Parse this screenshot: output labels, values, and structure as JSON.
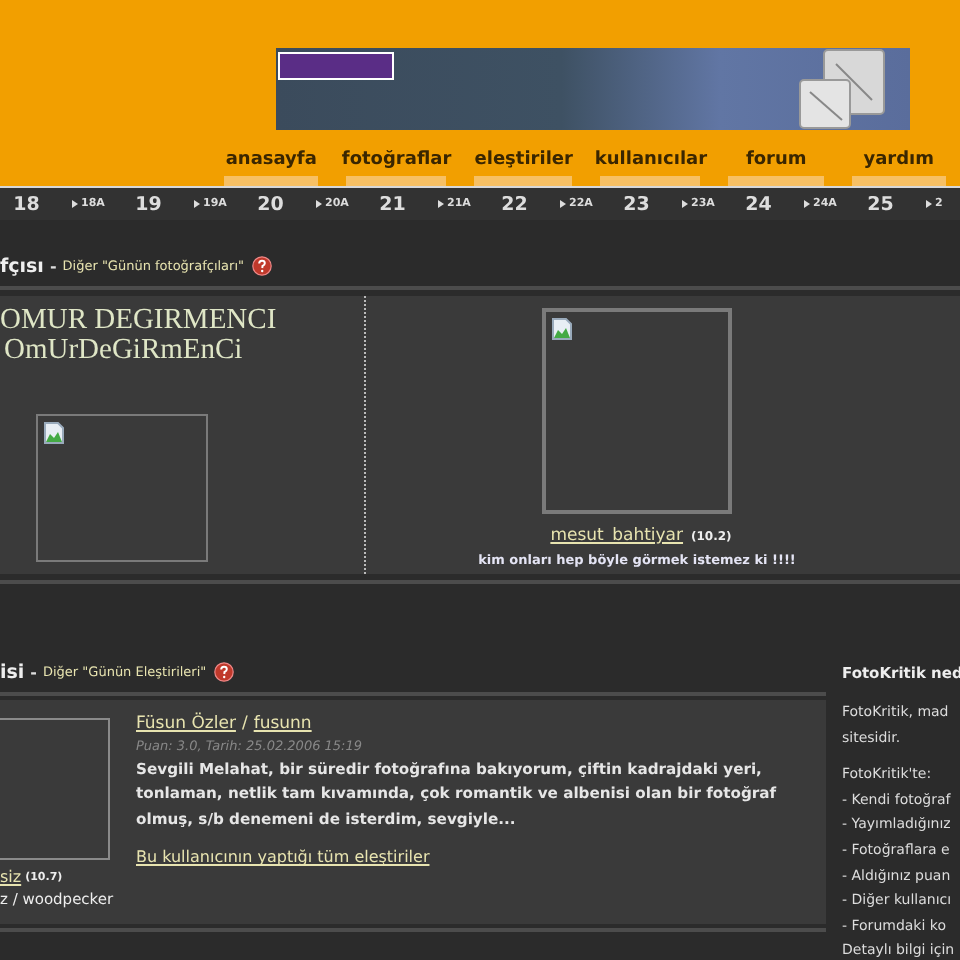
{
  "nav": [
    {
      "label": "anasayfa"
    },
    {
      "label": "fotoğraflar"
    },
    {
      "label": "eleştiriler"
    },
    {
      "label": "kullanıcılar"
    },
    {
      "label": "forum"
    },
    {
      "label": "yardım"
    }
  ],
  "date_strip": [
    {
      "label": "18",
      "kind": "day"
    },
    {
      "label": "18A",
      "kind": "sub"
    },
    {
      "label": "19",
      "kind": "day"
    },
    {
      "label": "19A",
      "kind": "sub"
    },
    {
      "label": "20",
      "kind": "day"
    },
    {
      "label": "20A",
      "kind": "sub"
    },
    {
      "label": "21",
      "kind": "day"
    },
    {
      "label": "21A",
      "kind": "sub"
    },
    {
      "label": "22",
      "kind": "day"
    },
    {
      "label": "22A",
      "kind": "sub"
    },
    {
      "label": "23",
      "kind": "day"
    },
    {
      "label": "23A",
      "kind": "sub"
    },
    {
      "label": "24",
      "kind": "day"
    },
    {
      "label": "24A",
      "kind": "sub"
    },
    {
      "label": "25",
      "kind": "day"
    },
    {
      "label": "2",
      "kind": "sub"
    }
  ],
  "photo_section": {
    "title": "fçısı",
    "dash": "-",
    "link": "Diğer \"Günün fotoğrafçıları\"",
    "name": "OMUR DEGIRMENCI",
    "nick": "OmUrDeGiRmEnCi",
    "user": "mesut_bahtiyar",
    "score": "(10.2)",
    "caption": "kim onları hep böyle görmek istemez ki !!!!"
  },
  "critique_section": {
    "title": "isi",
    "dash": "-",
    "link": "Diğer \"Günün Eleştirileri\"",
    "owner": "siz",
    "owner_score": "(10.7)",
    "owner_names": "z / woodpecker",
    "author": "Füsun Özler",
    "separator": "/",
    "author_nick": "fusunn",
    "meta": "Puan: 3.0, Tarih: 25.02.2006 15:19",
    "text": "Sevgili Melahat, bir süredir fotoğrafına bakıyorum, çiftin kadrajdaki yeri, tonlaman, netlik tam kıvamında, çok romantik ve albenisi olan bir fotoğraf olmuş, s/b denemeni de isterdim, sevgiyle...",
    "more_link": "Bu kullanıcının yaptığı tüm eleştiriler"
  },
  "sidebar": {
    "title": "FotoKritik ned",
    "intro": [
      "FotoKritik, mad",
      "sitesidir."
    ],
    "heading": "FotoKritik'te:",
    "items": [
      "- Kendi fotoğraf",
      "- Yayımladığınız",
      "- Fotoğraflara e",
      "- Aldığınız puan",
      "- Diğer kullanıcı",
      "- Forumdaki ko"
    ],
    "footer": "Detaylı bilgi için"
  }
}
